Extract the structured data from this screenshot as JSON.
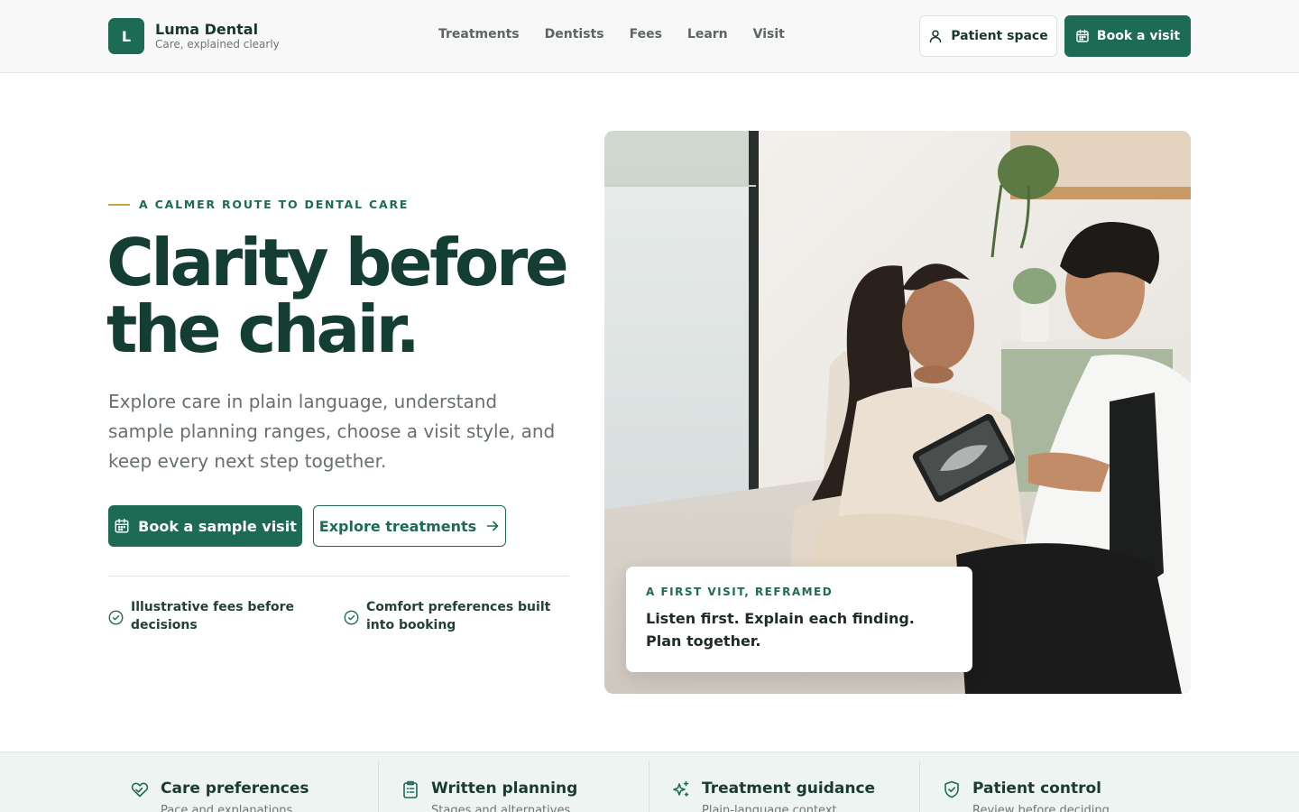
{
  "brand": {
    "mark": "L",
    "name": "Luma Dental",
    "tagline": "Care, explained clearly"
  },
  "nav": {
    "items": [
      {
        "label": "Treatments"
      },
      {
        "label": "Dentists"
      },
      {
        "label": "Fees"
      },
      {
        "label": "Learn"
      },
      {
        "label": "Visit"
      }
    ]
  },
  "header_actions": {
    "patient_space": {
      "label": "Patient space",
      "icon": "user-icon"
    },
    "book": {
      "label": "Book a visit",
      "icon": "calendar-icon"
    }
  },
  "hero": {
    "eyebrow": "A CALMER ROUTE TO DENTAL CARE",
    "headline_line1": "Clarity before",
    "headline_line2": "the chair.",
    "lede": "Explore care in plain language, understand sample planning ranges, choose a visit style, and keep every next step together.",
    "primary_cta": "Book a sample visit",
    "secondary_cta": "Explore treatments",
    "assurances": [
      {
        "text": "Illustrative fees before decisions",
        "icon": "check-circle-icon"
      },
      {
        "text": "Comfort preferences built into booking",
        "icon": "check-circle-icon"
      }
    ],
    "image_caption": {
      "eyebrow": "A FIRST VISIT, REFRAMED",
      "text": "Listen first. Explain each finding. Plan together."
    }
  },
  "features": [
    {
      "title": "Care preferences",
      "subtitle": "Pace and explanations",
      "icon": "heart-hand-icon"
    },
    {
      "title": "Written planning",
      "subtitle": "Stages and alternatives",
      "icon": "clipboard-icon"
    },
    {
      "title": "Treatment guidance",
      "subtitle": "Plain-language context",
      "icon": "sparkle-icon"
    },
    {
      "title": "Patient control",
      "subtitle": "Review before deciding",
      "icon": "shield-check-icon"
    }
  ],
  "colors": {
    "brand_green": "#1d6a55",
    "headline_green": "#143d33",
    "accent_gold": "#d0a43f",
    "strip_bg": "#edf4f2"
  }
}
